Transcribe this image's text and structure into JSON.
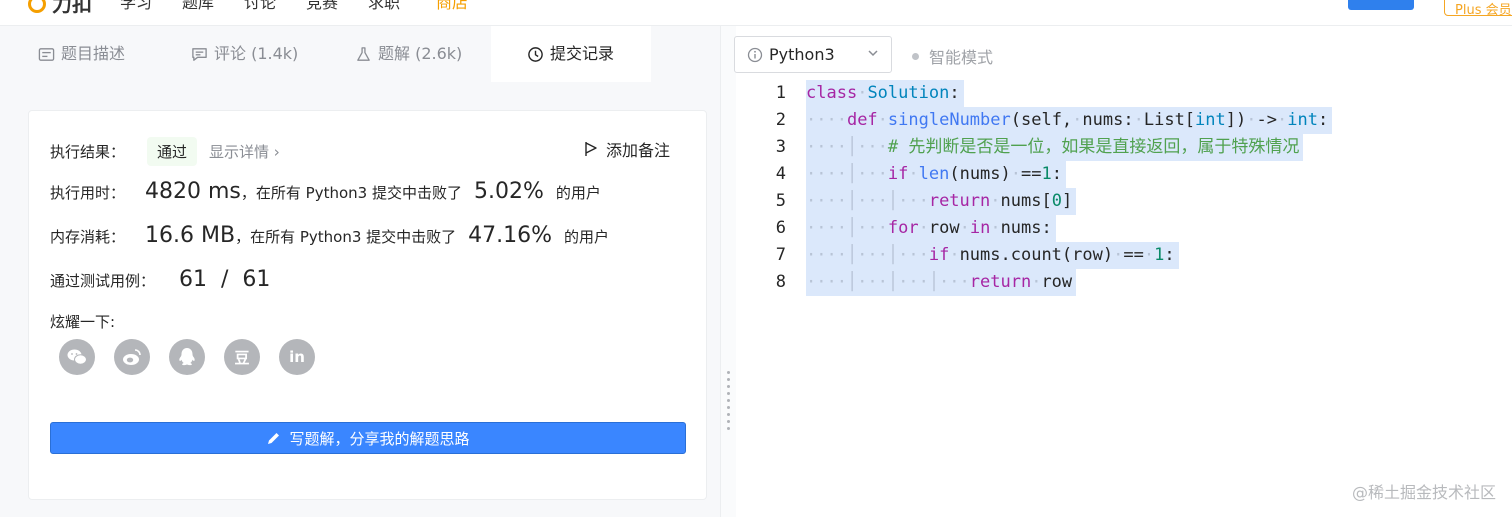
{
  "topbar": {
    "logo": "力扣",
    "nav": [
      "学习",
      "题库",
      "讨论",
      "竞赛",
      "求职"
    ],
    "store": "商店",
    "plus": "Plus 会员"
  },
  "tabs": [
    {
      "label": "题目描述",
      "icon": "description-icon"
    },
    {
      "label": "评论 (1.4k)",
      "icon": "comment-icon"
    },
    {
      "label": "题解 (2.6k)",
      "icon": "flask-icon"
    },
    {
      "label": "提交记录",
      "icon": "clock-icon"
    }
  ],
  "result": {
    "exec_label": "执行结果：",
    "status": "通过",
    "detail": "显示详情 ›",
    "add_note": "添加备注",
    "time_label": "执行用时：",
    "time_value": "4820 ms",
    "time_text": "，在所有 Python3 提交中击败了",
    "time_pct": "5.02%",
    "users_suffix": "的用户",
    "mem_label": "内存消耗：",
    "mem_value": "16.6 MB",
    "mem_text": "，在所有 Python3 提交中击败了",
    "mem_pct": "47.16%",
    "tests_label": "通过测试用例：",
    "tests_value": "61  /  61",
    "share_label": "炫耀一下:",
    "share_icons": [
      "wechat-icon",
      "weibo-icon",
      "qq-icon",
      "douban-icon",
      "linkedin-icon"
    ],
    "douban_glyph": "豆",
    "linkedin_glyph": "in",
    "write_button": "写题解，分享我的解题思路"
  },
  "editor": {
    "language": "Python3",
    "smart_mode": "智能模式",
    "line_numbers": [
      "1",
      "2",
      "3",
      "4",
      "5",
      "6",
      "7",
      "8"
    ]
  },
  "watermark": "@稀土掘金技术社区"
}
